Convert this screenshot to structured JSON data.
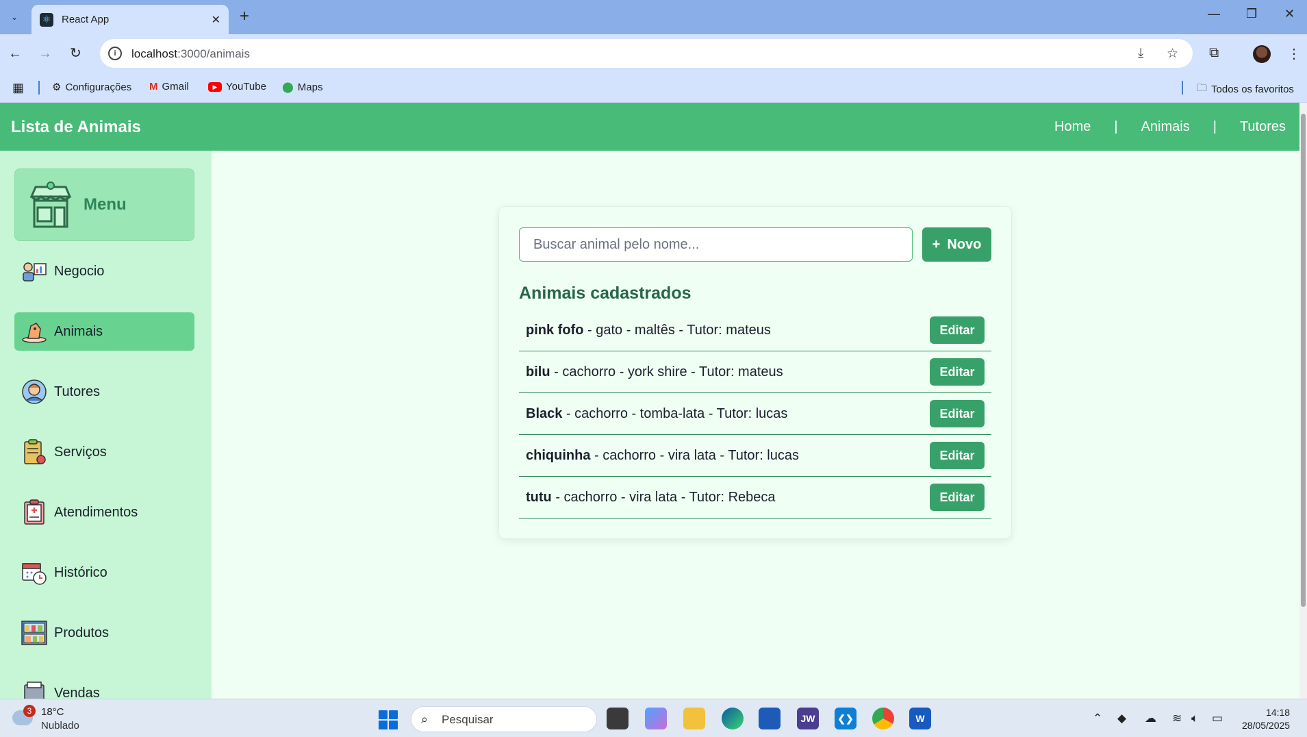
{
  "browser": {
    "tab_title": "React App",
    "url_host": "localhost",
    "url_rest": ":3000/animais",
    "bookmarks": [
      "Configurações",
      "Gmail",
      "YouTube",
      "Maps"
    ],
    "all_bookmarks": "Todos os favoritos"
  },
  "header": {
    "brand": "Lista de Animais",
    "nav": [
      "Home",
      "Animais",
      "Tutores"
    ],
    "nav_separator": "|"
  },
  "sidebar": {
    "menu_title": "Menu",
    "items": [
      {
        "label": "Negocio",
        "icon": "business-icon",
        "active": false
      },
      {
        "label": "Animais",
        "icon": "pet-icon",
        "active": true
      },
      {
        "label": "Tutores",
        "icon": "person-icon",
        "active": false
      },
      {
        "label": "Serviços",
        "icon": "clipboard-icon",
        "active": false
      },
      {
        "label": "Atendimentos",
        "icon": "medical-record-icon",
        "active": false
      },
      {
        "label": "Histórico",
        "icon": "calendar-icon",
        "active": false
      },
      {
        "label": "Produtos",
        "icon": "shelf-icon",
        "active": false
      },
      {
        "label": "Vendas",
        "icon": "register-icon",
        "active": false
      }
    ]
  },
  "content": {
    "search_placeholder": "Buscar animal pelo nome...",
    "new_plus": "+",
    "new_label": "Novo",
    "list_title": "Animais cadastrados",
    "edit_label": "Editar",
    "animals": [
      {
        "name": "pink fofo",
        "details": " - gato - maltês - Tutor: mateus"
      },
      {
        "name": "bilu",
        "details": " - cachorro - york shire - Tutor: mateus"
      },
      {
        "name": "Black",
        "details": " - cachorro - tomba-lata - Tutor: lucas"
      },
      {
        "name": "chiquinha",
        "details": " - cachorro - vira lata - Tutor: lucas"
      },
      {
        "name": "tutu",
        "details": " - cachorro - vira lata - Tutor: Rebeca"
      }
    ]
  },
  "taskbar": {
    "weather_badge": "3",
    "temperature": "18°C",
    "weather": "Nublado",
    "search": "Pesquisar",
    "time": "14:18",
    "date": "28/05/2025"
  },
  "colors": {
    "header": "#48bb78",
    "sidebar": "#c6f6d5",
    "active_item": "#68d391",
    "button": "#38a169",
    "title": "#276749"
  }
}
